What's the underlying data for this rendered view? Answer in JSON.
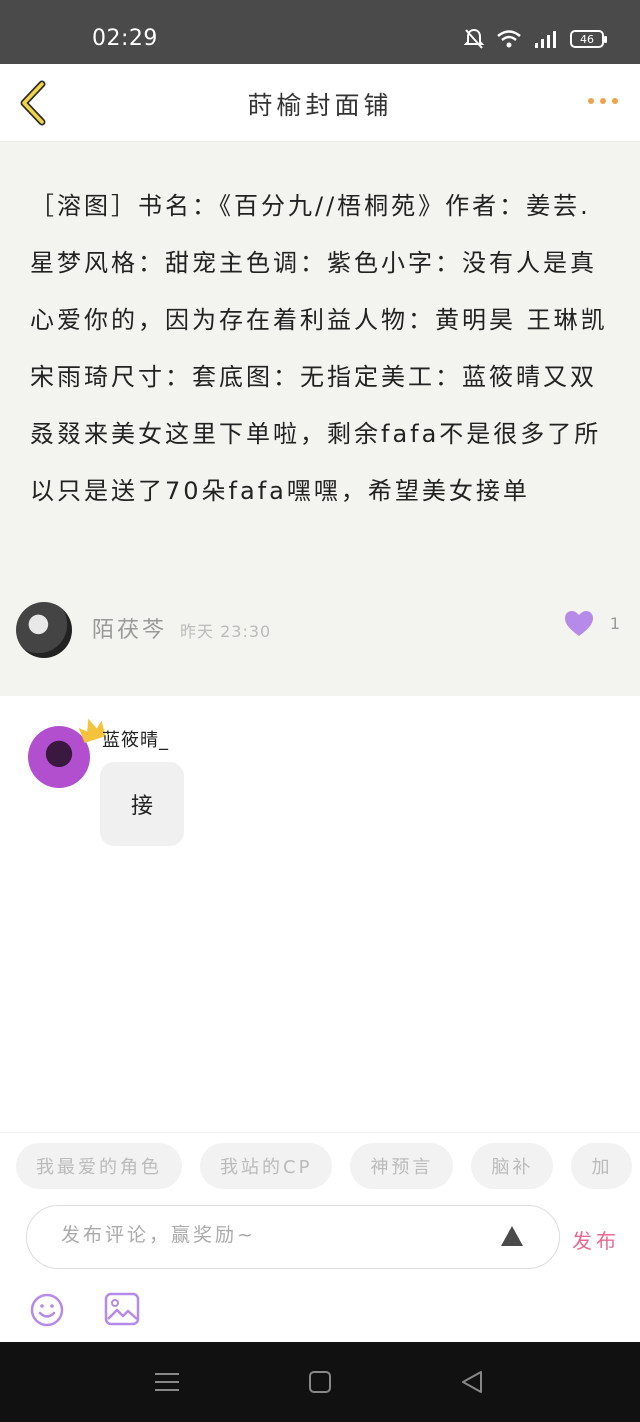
{
  "status_bar": {
    "time": "02:29",
    "battery": "46"
  },
  "nav": {
    "title": "莳榆封面铺"
  },
  "post": {
    "content": "［溶图］书名：《百分九//梧桐苑》作者：姜芸.星梦风格：甜宠主色调：紫色小字：没有人是真心爱你的，因为存在着利益人物：黄明昊 王琳凯 宋雨琦尺寸：套底图：无指定美工：蓝筱晴又双叒叕来美女这里下单啦，剩余fafa不是很多了所以只是送了70朵fafa嘿嘿，希望美女接单",
    "author": "陌茯芩",
    "time": "昨天 23:30",
    "likes": "1"
  },
  "reply": {
    "name": "蓝筱晴_",
    "text": "接"
  },
  "chips": [
    "我最爱的角色",
    "我站的CP",
    "神预言",
    "脑补",
    "加"
  ],
  "comment": {
    "placeholder": "发布评论，赢奖励~",
    "publish": "发布"
  },
  "colors": {
    "accent_pink": "#e96a8e",
    "like_purple": "#b58ae8",
    "more_orange": "#f0a24a"
  },
  "icons": [
    "back-chevron-icon",
    "more-dots-icon",
    "heart-icon",
    "crown-icon",
    "up-triangle-icon",
    "emoji-icon",
    "image-icon"
  ]
}
